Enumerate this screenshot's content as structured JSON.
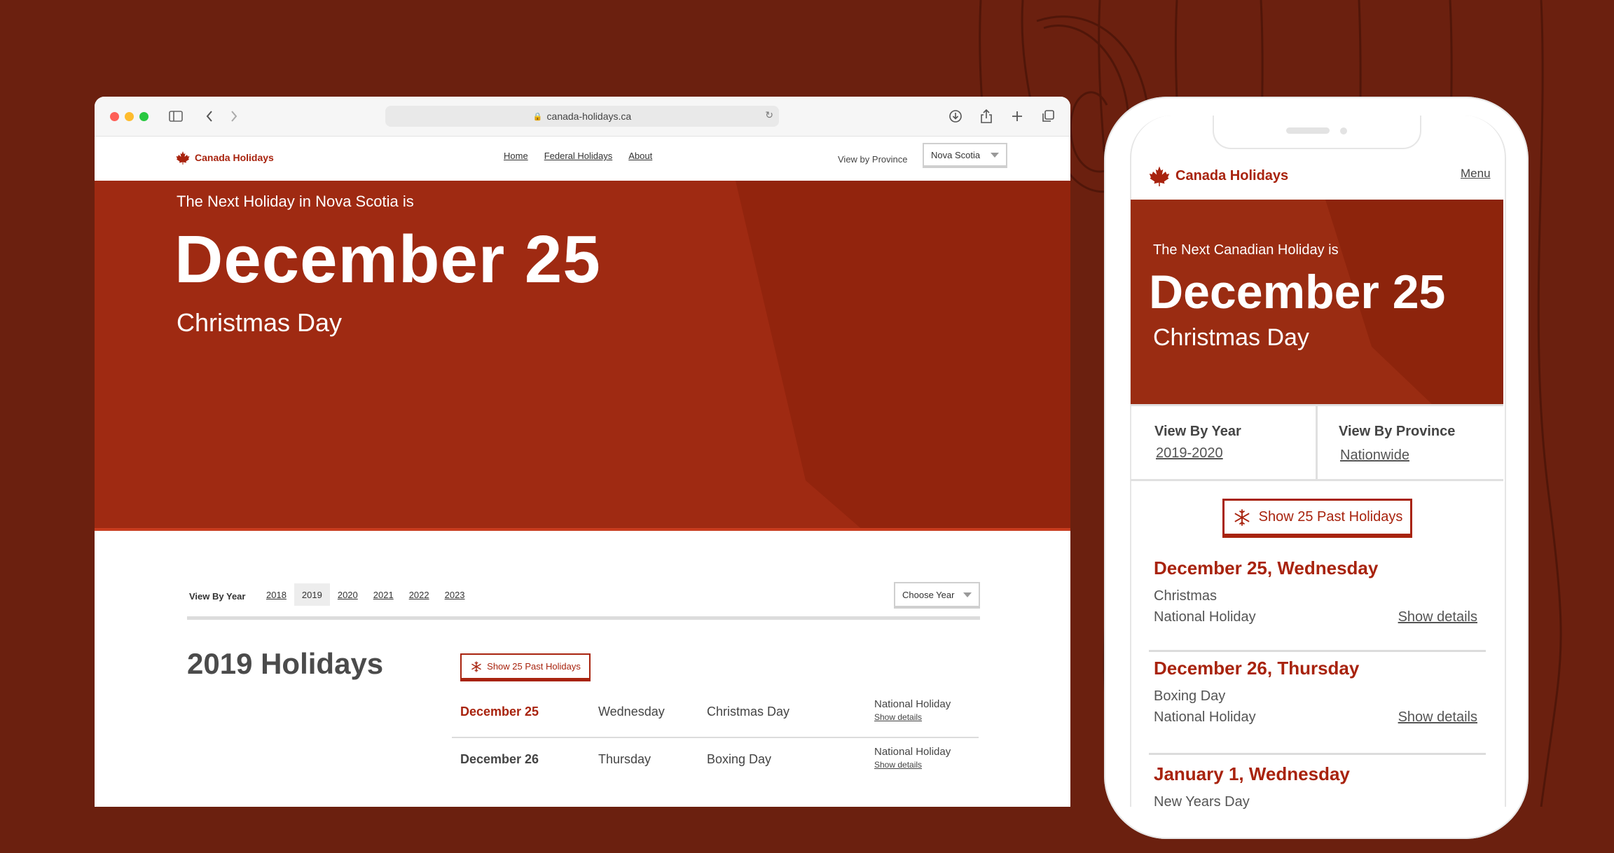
{
  "browser": {
    "url": "canada-holidays.ca"
  },
  "desktop": {
    "site_name": "Canada Holidays",
    "nav": [
      {
        "label": "Home"
      },
      {
        "label": "Federal Holidays"
      },
      {
        "label": "About"
      }
    ],
    "province_label": "View by Province",
    "province_select": "Nova Scotia",
    "hero": {
      "subtitle": "The Next Holiday in Nova Scotia is",
      "date": "December 25",
      "holiday": "Christmas Day"
    },
    "year_bar": {
      "label": "View By Year",
      "years": [
        {
          "label": "2018"
        },
        {
          "label": "2019"
        },
        {
          "label": "2020"
        },
        {
          "label": "2021"
        },
        {
          "label": "2022"
        },
        {
          "label": "2023"
        }
      ],
      "selected": "2019",
      "select_label": "Choose Year"
    },
    "section_title": "2019 Holidays",
    "past_button": "Show 25 Past Holidays",
    "rows": [
      {
        "date": "December 25",
        "day": "Wednesday",
        "name": "Christmas Day",
        "type": "National Holiday",
        "link": "Show details"
      },
      {
        "date": "December 26",
        "day": "Thursday",
        "name": "Boxing Day",
        "type": "National Holiday",
        "link": "Show details"
      }
    ]
  },
  "mobile": {
    "site_name": "Canada Holidays",
    "menu": "Menu",
    "hero": {
      "subtitle": "The Next Canadian Holiday is",
      "date": "December 25",
      "holiday": "Christmas Day"
    },
    "view_year_label": "View By Year",
    "view_year_value": "2019-2020",
    "view_province_label": "View By Province",
    "view_province_value": "Nationwide",
    "past_button": "Show 25 Past Holidays",
    "items": [
      {
        "title": "December 25, Wednesday",
        "name": "Christmas",
        "type": "National Holiday",
        "link": "Show details"
      },
      {
        "title": "December 26, Thursday",
        "name": "Boxing Day",
        "type": "National Holiday",
        "link": "Show details"
      },
      {
        "title": "January 1, Wednesday",
        "name": "New Years Day"
      }
    ]
  },
  "colors": {
    "background": "#6b200f",
    "hero": "#9f2a12",
    "accent": "#a8230e"
  },
  "icons": [
    "maple-leaf-icon",
    "snowflake-icon",
    "lock-icon",
    "reload-icon",
    "sidebar-icon",
    "back-icon",
    "forward-icon",
    "download-icon",
    "share-icon",
    "new-tab-icon",
    "tabs-icon"
  ]
}
